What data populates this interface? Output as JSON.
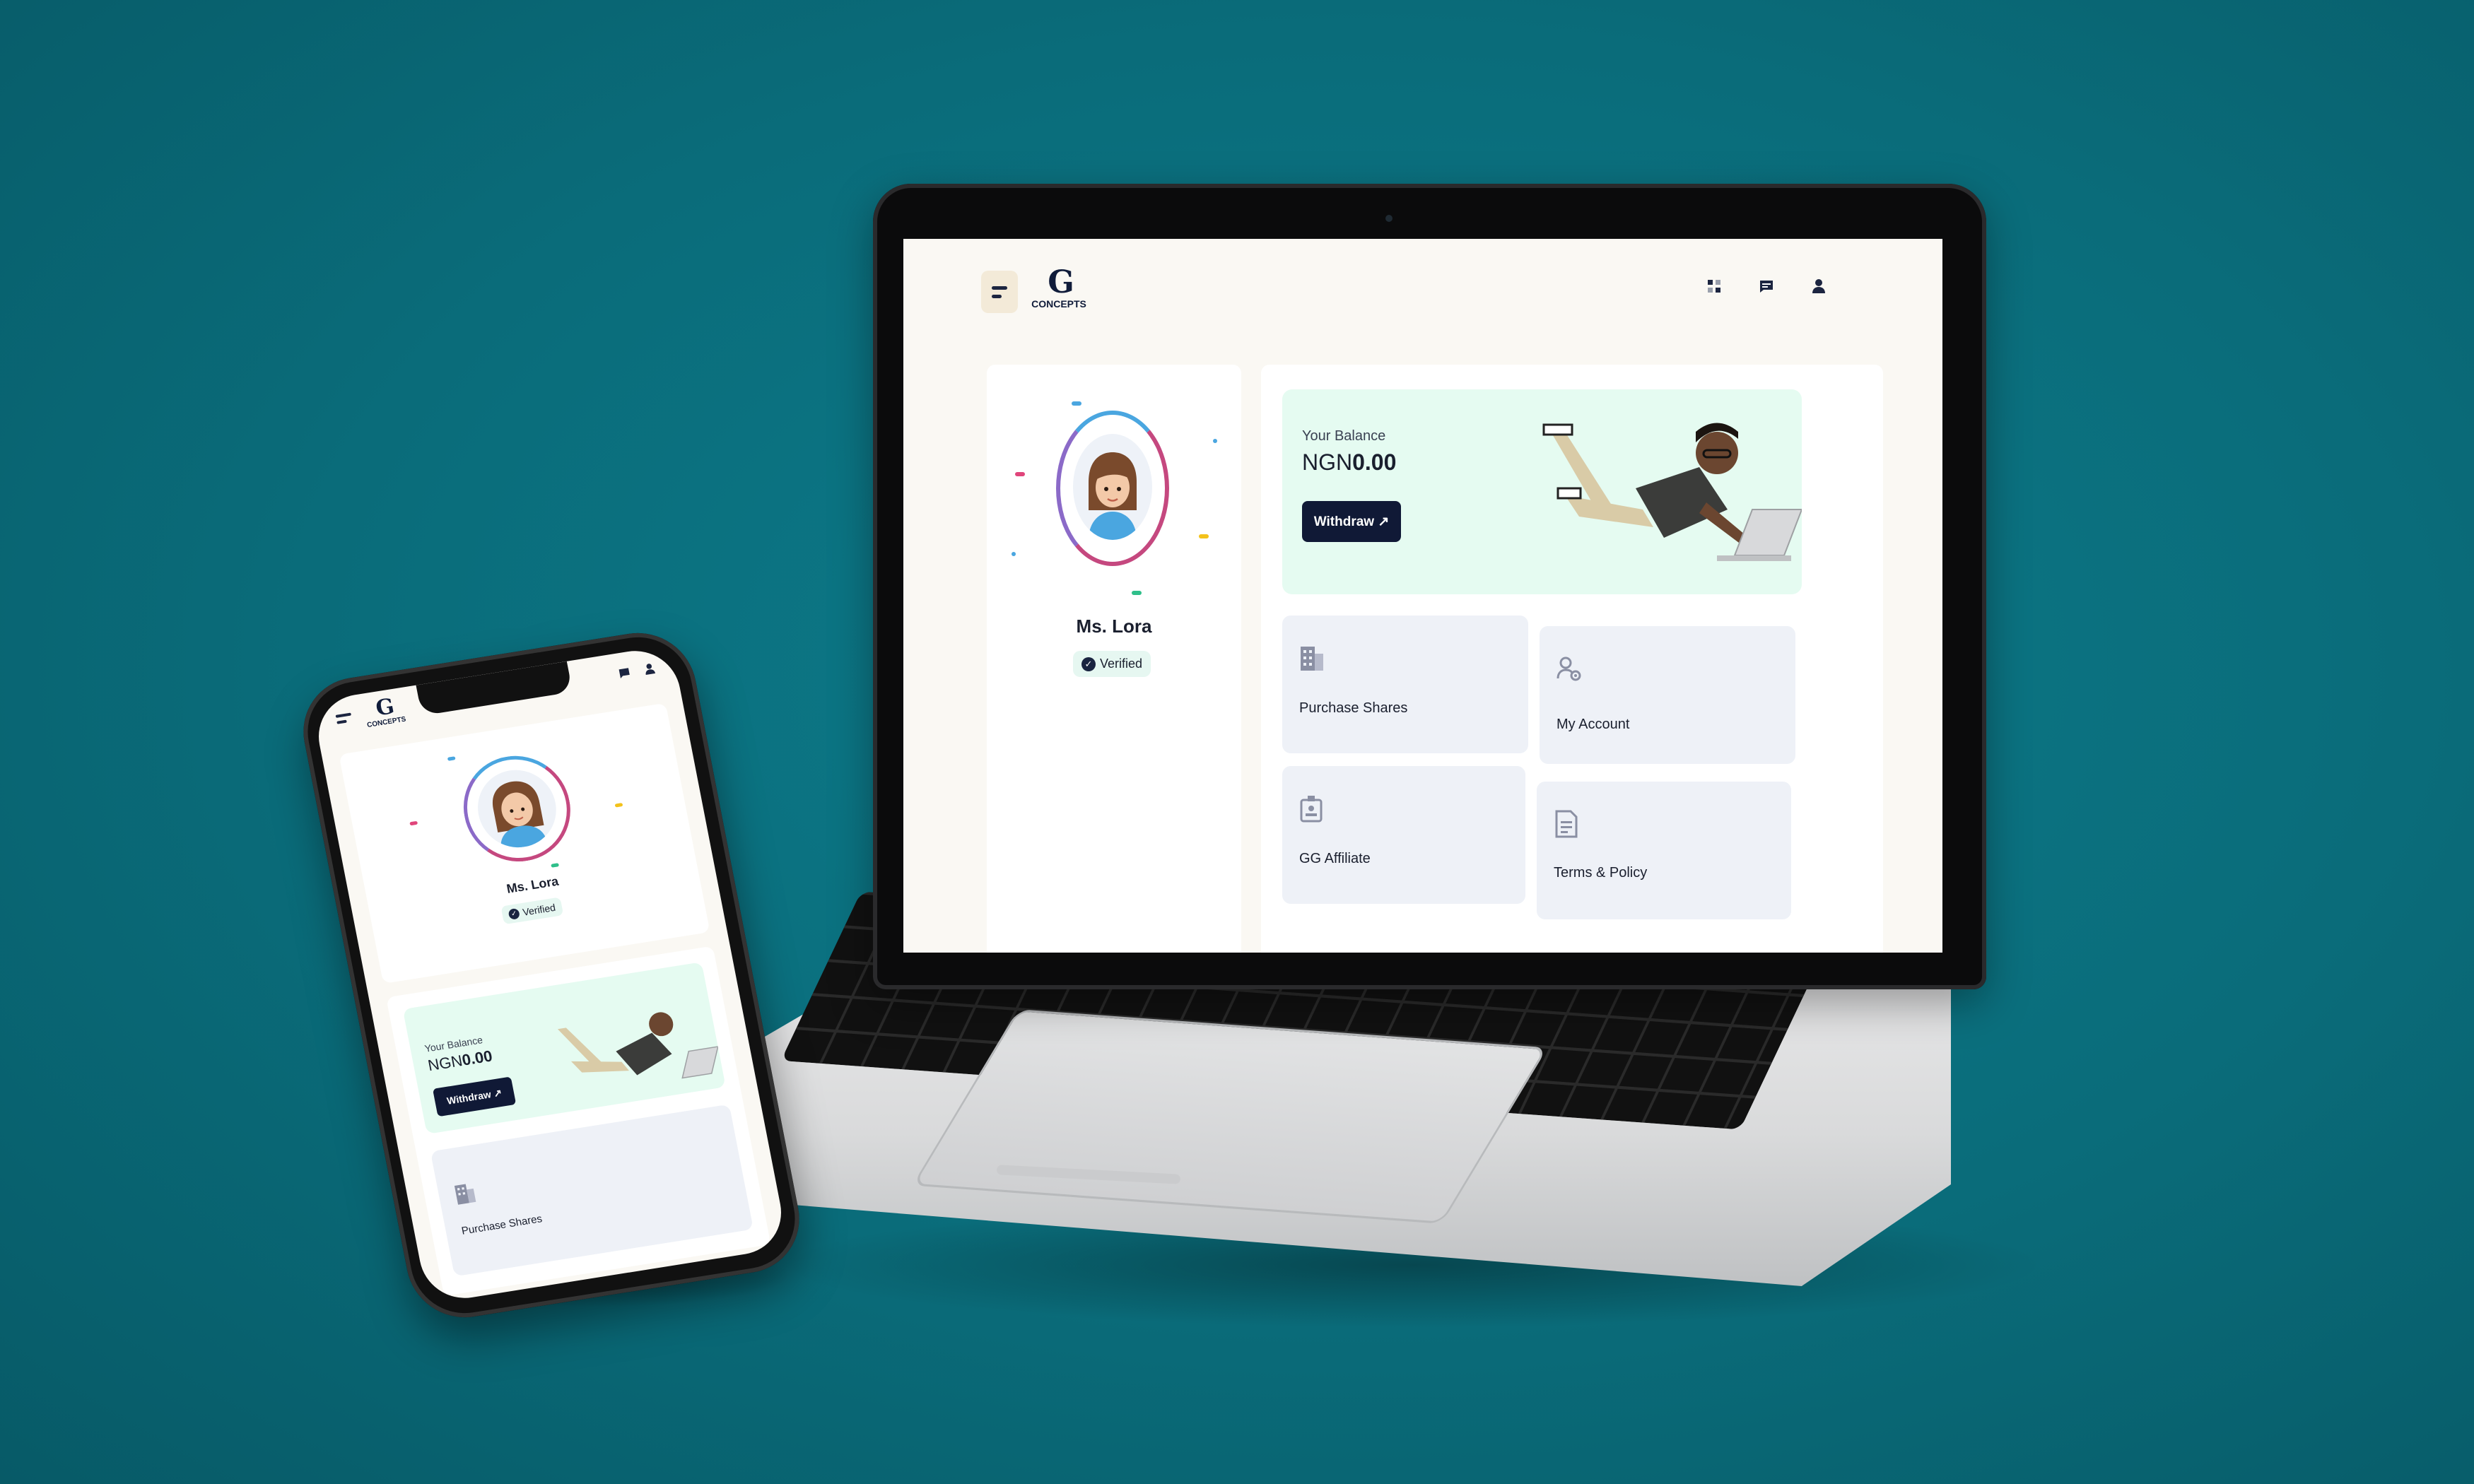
{
  "app": {
    "logo_mark": "G",
    "logo_word": "CONCEPTS"
  },
  "header": {
    "icons": [
      "grid-icon",
      "message-icon",
      "user-icon"
    ]
  },
  "profile": {
    "name": "Ms. Lora",
    "verified_label": "Verified"
  },
  "balance": {
    "label": "Your Balance",
    "currency": "NGN",
    "amount": "0.00",
    "withdraw_label": "Withdraw ↗"
  },
  "tiles": [
    {
      "label": "Purchase Shares",
      "icon": "building-icon"
    },
    {
      "label": "My Account",
      "icon": "user-settings-icon"
    },
    {
      "label": "GG Affiliate",
      "icon": "id-badge-icon"
    },
    {
      "label": "Terms & Policy",
      "icon": "document-icon"
    }
  ],
  "colors": {
    "background": "#0a6c7a",
    "accent_dark": "#101936",
    "balance_card": "#e5fbf1",
    "tile_bg": "#eef1f7",
    "verified_bg": "#e6f7f1"
  }
}
